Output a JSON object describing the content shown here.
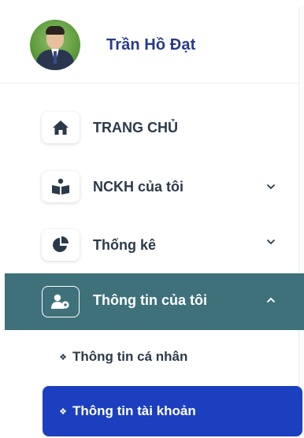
{
  "user": {
    "name": "Trần Hồ Đạt",
    "avatar_icon": "user-avatar"
  },
  "menu": [
    {
      "label": "TRANG CHỦ",
      "icon": "home-icon",
      "expandable": false
    },
    {
      "label": "NCKH của tôi",
      "icon": "research-icon",
      "expandable": true,
      "expanded": false
    },
    {
      "label": "Thống kê",
      "icon": "pie-chart-icon",
      "expandable": true,
      "expanded": false
    },
    {
      "label": "Thông tin của tôi",
      "icon": "user-settings-icon",
      "expandable": true,
      "expanded": true,
      "active": true
    }
  ],
  "submenu": [
    {
      "bullet": "❖",
      "label": "Thông tin cá nhân",
      "active": false
    },
    {
      "bullet": "❖",
      "label": "Thông tin tài khoản",
      "active": true
    }
  ],
  "colors": {
    "user_name": "#283c8c",
    "active_section_bg": "#3f717a",
    "active_subitem_bg": "#1c3fbf",
    "text": "#2b3a4a"
  }
}
